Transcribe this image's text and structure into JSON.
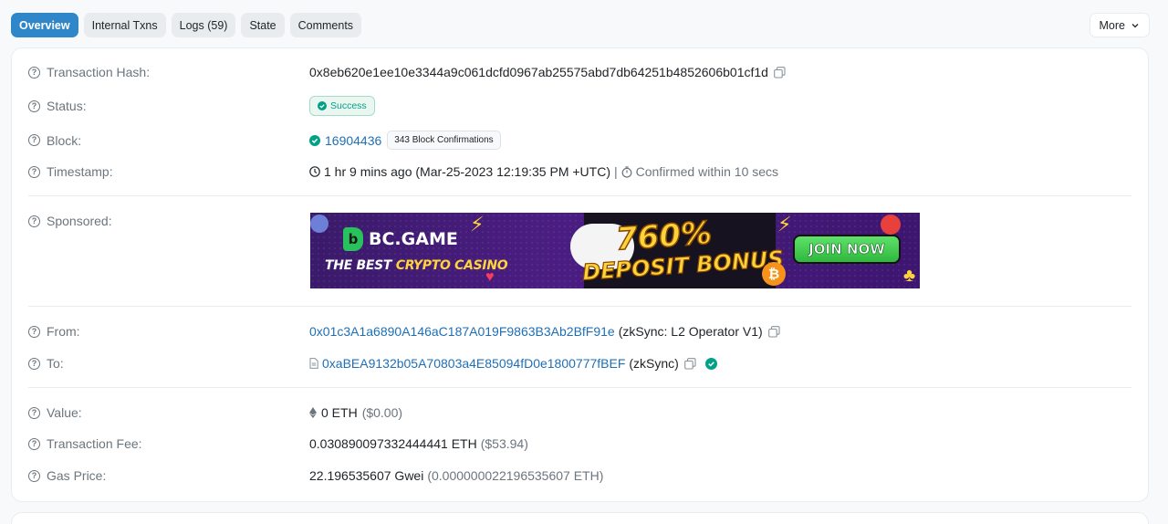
{
  "tabs": [
    {
      "label": "Overview"
    },
    {
      "label": "Internal Txns"
    },
    {
      "label": "Logs (59)"
    },
    {
      "label": "State"
    },
    {
      "label": "Comments"
    }
  ],
  "more_label": "More",
  "rows": {
    "tx_hash": {
      "label": "Transaction Hash:",
      "value": "0x8eb620e1ee10e3344a9c061dcfd0967ab25575abd7db64251b4852606b01cf1d"
    },
    "status": {
      "label": "Status:",
      "value": "Success"
    },
    "block": {
      "label": "Block:",
      "value": "16904436",
      "confirmations": "343 Block Confirmations"
    },
    "timestamp": {
      "label": "Timestamp:",
      "value": "1 hr 9 mins ago (Mar-25-2023 12:19:35 PM +UTC)",
      "separator": "|",
      "confirmed": "Confirmed within 10 secs"
    },
    "sponsored": {
      "label": "Sponsored:"
    },
    "from": {
      "label": "From:",
      "address": "0x01c3A1a6890A146aC187A019F9863B3Ab2BfF91e",
      "name": "(zkSync: L2 Operator V1)"
    },
    "to": {
      "label": "To:",
      "address": "0xaBEA9132b05A70803a4E85094fD0e1800777fBEF",
      "name": "(zkSync)"
    },
    "value": {
      "label": "Value:",
      "amount": "0 ETH",
      "usd": "($0.00)"
    },
    "fee": {
      "label": "Transaction Fee:",
      "amount": "0.030890097332444441 ETH",
      "usd": "($53.94)"
    },
    "gas": {
      "label": "Gas Price:",
      "amount": "22.196535607 Gwei",
      "eth": "(0.000000022196535607 ETH)"
    }
  },
  "banner": {
    "brand": "BC.GAME",
    "tagline_prefix": "THE BEST ",
    "tagline_highlight": "CRYPTO CASINO",
    "bonus_line1": "760%",
    "bonus_line2": "DEPOSIT BONUS",
    "cta": "JOIN NOW"
  },
  "colors": {
    "accent": "#2f86c8",
    "link": "#1e6fb5",
    "success": "#00a186"
  }
}
